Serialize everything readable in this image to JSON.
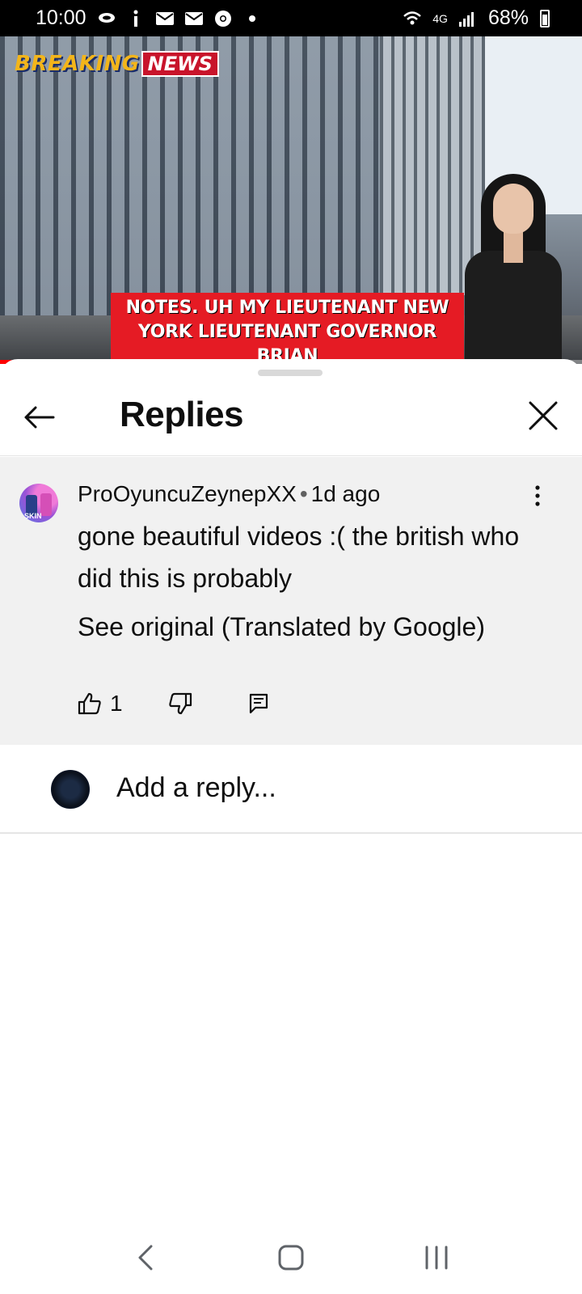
{
  "status_bar": {
    "time": "10:00",
    "notification_icons": [
      "chat-bubble-icon",
      "info-icon",
      "mail-icon",
      "mail-icon",
      "chrome-icon",
      "dot-icon"
    ],
    "network": "4G",
    "battery": "68%"
  },
  "video": {
    "breaking_label": "BREAKING",
    "news_label": "NEWS",
    "caption": "NOTES. UH MY LIEUTENANT NEW YORK LIEUTENANT GOVERNOR BRIAN",
    "progress": 0.08
  },
  "header": {
    "title": "Replies",
    "back_icon": "arrow-left-icon",
    "close_icon": "close-icon"
  },
  "comment": {
    "author": "ProOyuncuZeynepXX",
    "separator": "•",
    "time": "1d ago",
    "text": "gone beautiful videos :( the british who did this is probably",
    "see_original": "See original (Translated by Google)",
    "like_count": "1",
    "avatar_text": "SKIN"
  },
  "reply_box": {
    "placeholder": "Add a reply..."
  },
  "colors": {
    "accent_red": "#ff0000",
    "comment_bg": "#f1f1f1",
    "caption_red": "#e51b24"
  }
}
